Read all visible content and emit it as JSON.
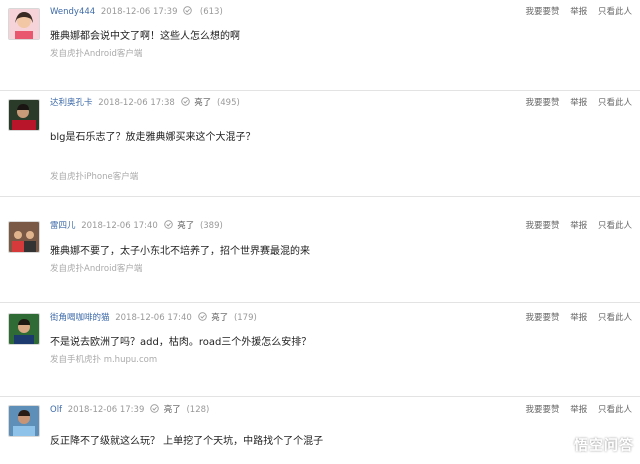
{
  "actions": {
    "report_bad": "我要要赞",
    "report": "举报",
    "only_this": "只看此人"
  },
  "lit_label": "亮了",
  "comments": [
    {
      "username": "Wendy444",
      "time": "2018-12-06 17:39",
      "lit_label": "",
      "count": "(613)",
      "text": "雅典娜都会说中文了啊！这些人怎么想的啊",
      "source": "发自虎扑Android客户端"
    },
    {
      "username": "达利奥孔卡",
      "time": "2018-12-06 17:38",
      "lit_label": "亮了",
      "count": "(495)",
      "text": "blg是石乐志了？放走雅典娜买来这个大混子？",
      "source": "发自虎扑iPhone客户端"
    },
    {
      "username": "雷四儿",
      "time": "2018-12-06 17:40",
      "lit_label": "亮了",
      "count": "(389)",
      "text": "雅典娜不要了，太子小东北不培养了，招个世界赛最混的来",
      "source": "发自虎扑Android客户端"
    },
    {
      "username": "街角喝咖啡的猫",
      "time": "2018-12-06 17:40",
      "lit_label": "亮了",
      "count": "(179)",
      "text": "不是说去欧洲了吗？add，枯肉。road三个外援怎么安排？",
      "source": "发自手机虎扑 m.hupu.com"
    },
    {
      "username": "Olf",
      "time": "2018-12-06 17:39",
      "lit_label": "亮了",
      "count": "(128)",
      "text": "反正降不了级就这么玩？ 上单挖了个天坑，中路找个了个混子",
      "source": ""
    }
  ],
  "watermark": "悟空问答",
  "colors": {
    "username": "#3d6aa8",
    "divider": "#e3e3e3",
    "meta": "#999999"
  }
}
